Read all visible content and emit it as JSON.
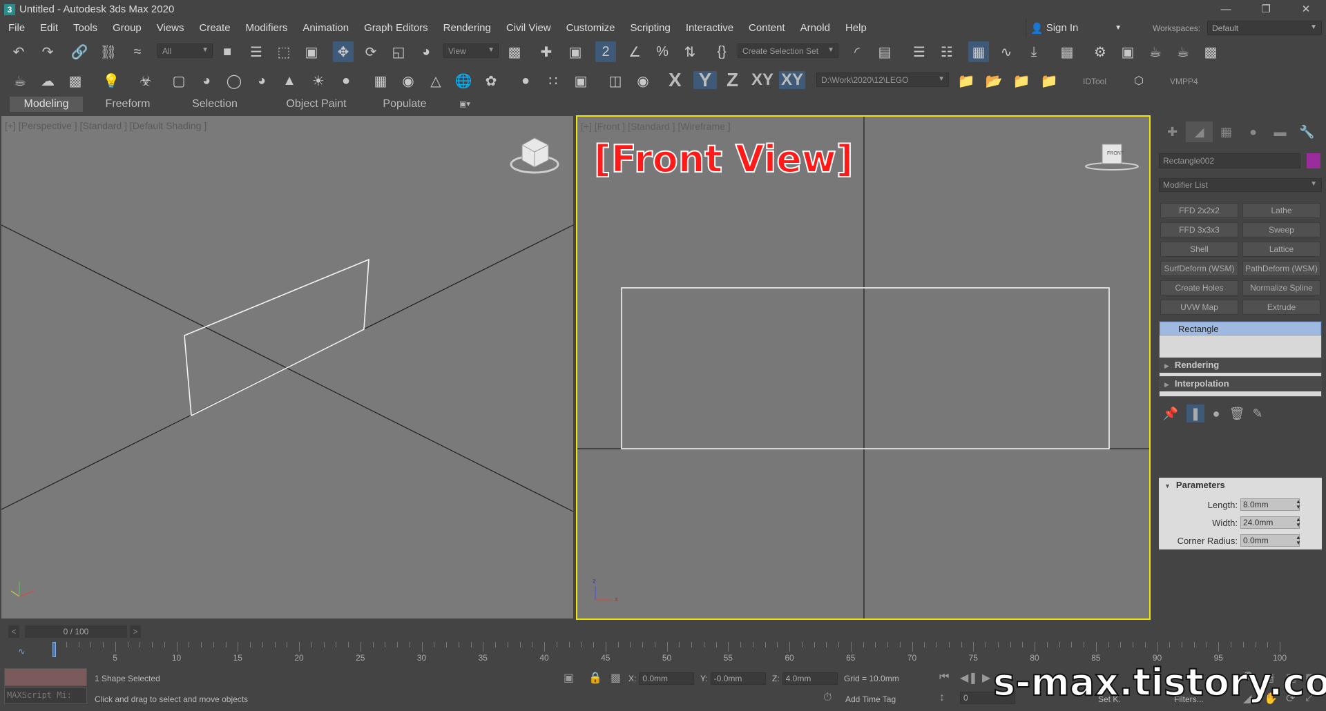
{
  "window": {
    "title": "Untitled - Autodesk 3ds Max 2020",
    "app_icon": "3",
    "controls": [
      "—",
      "❐",
      "✕"
    ]
  },
  "menu": [
    "File",
    "Edit",
    "Tools",
    "Group",
    "Views",
    "Create",
    "Modifiers",
    "Animation",
    "Graph Editors",
    "Rendering",
    "Civil View",
    "Customize",
    "Scripting",
    "Interactive",
    "Content",
    "Arnold",
    "Help"
  ],
  "sign_in": "Sign In",
  "workspaces": {
    "label": "Workspaces:",
    "value": "Default"
  },
  "toolbar1": {
    "selection_filter": "All",
    "ref_coord": "View",
    "named_selection": "Create Selection Set"
  },
  "toolbar2": {
    "axis_x": "X",
    "axis_y": "Y",
    "axis_z": "Z",
    "axis_xy": "XY",
    "axis_xy2": "XY",
    "project_path": "D:\\Work\\2020\\12\\LEGO",
    "idtool": "IDTool",
    "vmpp": "VMPP4"
  },
  "ribbon_tabs": [
    "Modeling",
    "Freeform",
    "Selection",
    "Object Paint",
    "Populate"
  ],
  "viewport_left": {
    "label": "[+] [Perspective ] [Standard ] [Default Shading ]"
  },
  "viewport_right": {
    "label": "[+] [Front ] [Standard ] [Wireframe ]",
    "overlay": "[Front View]",
    "cube_label": "FRONT"
  },
  "command_panel": {
    "object_name": "Rectangle002",
    "object_color": "#9b2c9b",
    "modifier_list": "Modifier List",
    "modifier_buttons": [
      "FFD 2x2x2",
      "Lathe",
      "FFD 3x3x3",
      "Sweep",
      "Shell",
      "Lattice",
      "SurfDeform (WSM)",
      "PathDeform (WSM)",
      "Create Holes",
      "Normalize Spline",
      "UVW Map",
      "Extrude"
    ],
    "stack_item": "Rectangle",
    "rollouts": [
      "Rendering",
      "Interpolation"
    ],
    "parameters": {
      "title": "Parameters",
      "length_label": "Length:",
      "length": "8.0mm",
      "width_label": "Width:",
      "width": "24.0mm",
      "corner_label": "Corner Radius:",
      "corner": "0.0mm"
    }
  },
  "timeline": {
    "slider": "0 / 100",
    "prev": "<",
    "next": ">",
    "tick_labels": [
      "5",
      "10",
      "15",
      "20",
      "25",
      "30",
      "35",
      "40",
      "45",
      "50",
      "55",
      "60",
      "65",
      "70",
      "75",
      "80",
      "85",
      "90",
      "95",
      "100"
    ]
  },
  "status": {
    "maxscript": "MAXScript Mi:",
    "selected": "1 Shape Selected",
    "prompt": "Click and drag to select and move objects",
    "x_label": "X:",
    "x": "0.0mm",
    "y_label": "Y:",
    "y": "-0.0mm",
    "z_label": "Z:",
    "z": "4.0mm",
    "grid": "Grid = 10.0mm",
    "add_time_tag": "Add Time Tag",
    "frame": "0",
    "set_key": "Set K.",
    "filters": "Filters..."
  },
  "watermark": "s-max.tistory.com"
}
